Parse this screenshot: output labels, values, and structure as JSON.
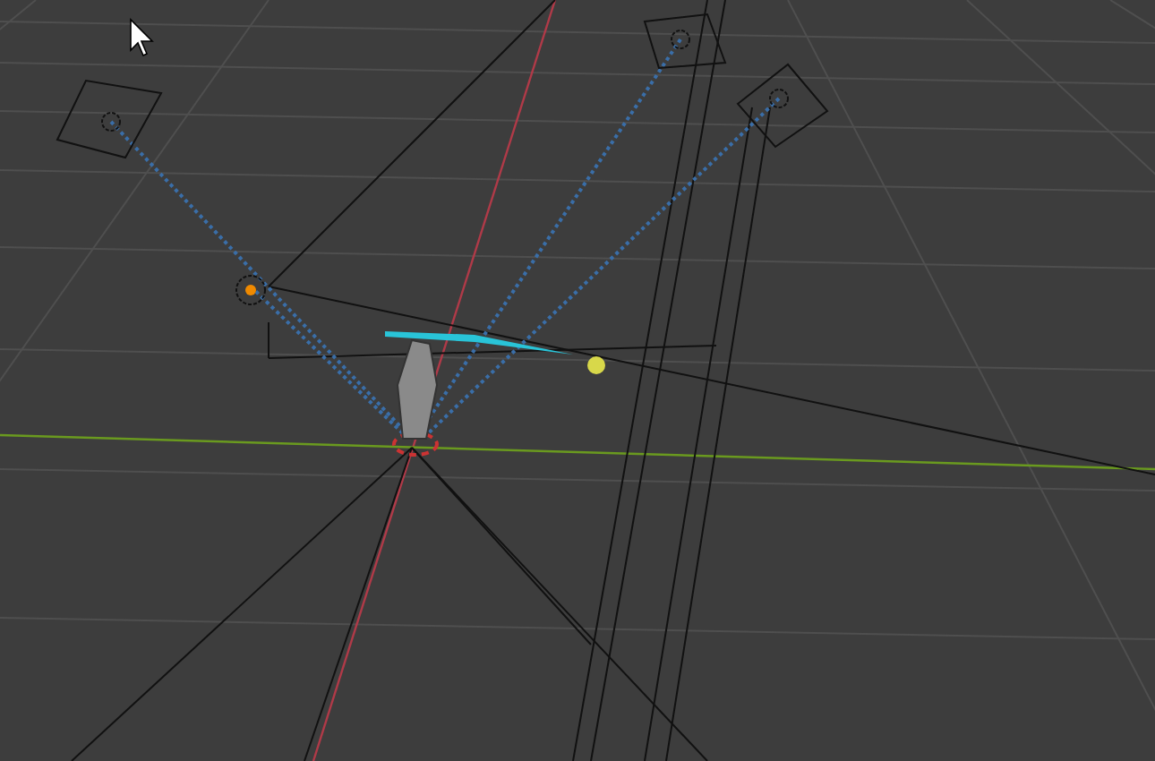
{
  "cursor": {
    "visible": true
  }
}
